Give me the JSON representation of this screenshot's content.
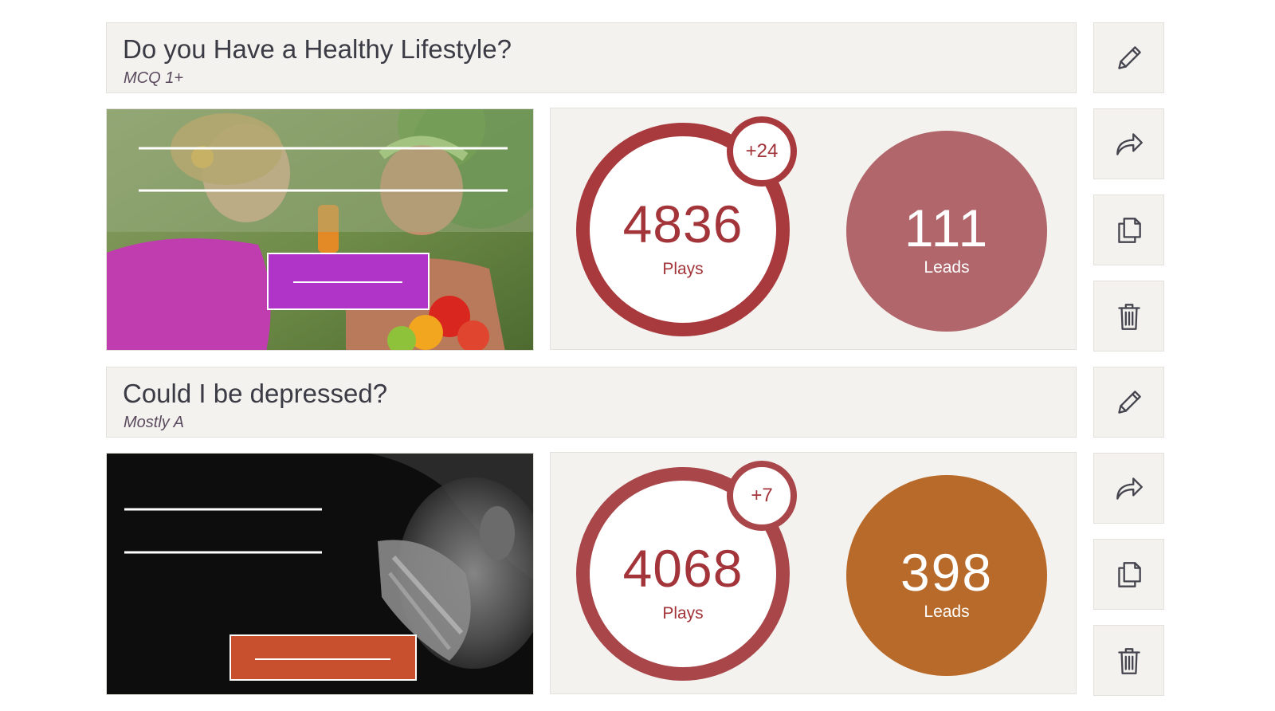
{
  "quizzes": [
    {
      "title": "Do you Have a Healthy Lifestyle?",
      "type": "MCQ 1+",
      "thumbnail_icon": "healthy-lifestyle-photo",
      "plays": "4836",
      "plays_label": "Plays",
      "delta": "+24",
      "leads": "111",
      "leads_label": "Leads",
      "ring_color": "#a83a3e",
      "leads_color": "#b0666a",
      "cta_color": "#b034c8"
    },
    {
      "title": "Could I be depressed?",
      "type": "Mostly A",
      "thumbnail_icon": "depressed-man-photo",
      "plays": "4068",
      "plays_label": "Plays",
      "delta": "+7",
      "leads": "398",
      "leads_label": "Leads",
      "ring_color": "#a8464a",
      "leads_color": "#b86a2a",
      "cta_color": "#c9502e"
    }
  ],
  "actions": {
    "edit_icon": "pencil-icon",
    "share_icon": "share-arrow-icon",
    "duplicate_icon": "copy-icon",
    "delete_icon": "trash-icon"
  }
}
